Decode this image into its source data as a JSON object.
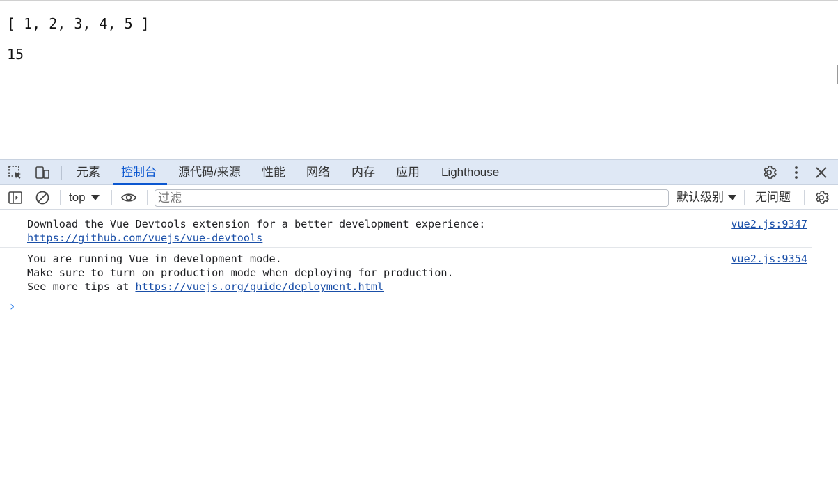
{
  "page": {
    "lines": [
      "[ 1, 2, 3, 4, 5 ]",
      "15"
    ]
  },
  "devtools": {
    "tabs": [
      {
        "label": "元素"
      },
      {
        "label": "控制台"
      },
      {
        "label": "源代码/来源"
      },
      {
        "label": "性能"
      },
      {
        "label": "网络"
      },
      {
        "label": "内存"
      },
      {
        "label": "应用"
      },
      {
        "label": "Lighthouse"
      }
    ],
    "active_tab": "控制台",
    "toolbar": {
      "context": "top",
      "filter_placeholder": "过滤",
      "levels": "默认级别",
      "issues": "无问题"
    },
    "console": {
      "messages": [
        {
          "line1": "Download the Vue Devtools extension for a better development experience:",
          "link": "https://github.com/vuejs/vue-devtools",
          "source": "vue2.js:9347"
        },
        {
          "line1": "You are running Vue in development mode.",
          "line2": "Make sure to turn on production mode when deploying for production.",
          "line3_prefix": "See more tips at ",
          "link": "https://vuejs.org/guide/deployment.html",
          "source": "vue2.js:9354"
        }
      ],
      "prompt": "›"
    },
    "colors": {
      "accent": "#0b57d0",
      "tabbar_bg": "#dfe8f5",
      "link": "#1a4fa8"
    },
    "icons": [
      "inspect-element-icon",
      "device-toolbar-icon",
      "settings-gear-icon",
      "more-vert-icon",
      "close-icon",
      "sidebar-toggle-icon",
      "clear-console-icon",
      "eye-icon",
      "console-settings-icon"
    ]
  }
}
